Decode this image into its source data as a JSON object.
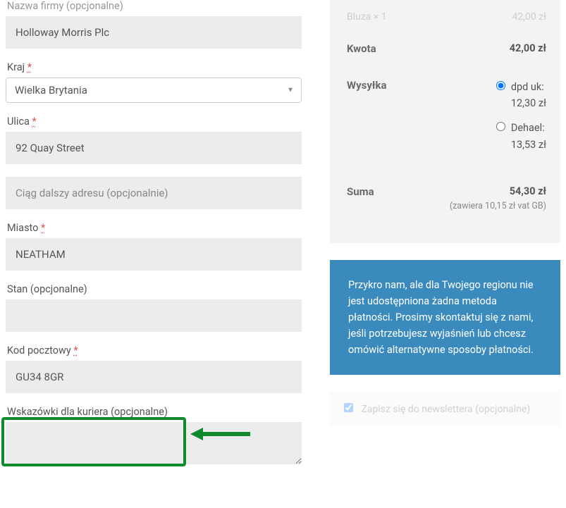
{
  "form": {
    "company_label": "Nazwa firmy (opcjonalne)",
    "company_value": "Holloway Morris Plc",
    "country_label": "Kraj",
    "country_value": "Wielka Brytania",
    "street_label": "Ulica",
    "street_value": "92 Quay Street",
    "street2_placeholder": "Ciąg dalszy adresu (opcjonalnie)",
    "city_label": "Miasto",
    "city_value": "NEATHAM",
    "state_label": "Stan (opcjonalne)",
    "state_value": "",
    "postcode_label": "Kod pocztowy",
    "postcode_value": "GU34 8GR",
    "courier_label": "Wskazówki dla kuriera (opcjonalne)"
  },
  "summary": {
    "item_name": "Bluza × 1",
    "item_price": "42,00 zł",
    "subtotal_label": "Kwota",
    "subtotal_value": "42,00 zł",
    "shipping_label": "Wysyłka",
    "ship_opt1_label": "dpd uk:",
    "ship_opt1_price": "12,30 zł",
    "ship_opt2_label": "Dehael:",
    "ship_opt2_price": "13,53 zł",
    "total_label": "Suma",
    "total_value": "54,30 zł",
    "vat_note": "(zawiera 10,15 zł vat GB)"
  },
  "info": {
    "message": "Przykro nam, ale dla Twojego regionu nie jest udostępniona żadna metoda płatności. Prosimy skontaktuj się z nami, jeśli potrzebujesz wyjaśnień lub chcesz omówić alternatywne sposoby płatności."
  },
  "newsletter": {
    "label": "Zapisz się do newslettera (opcjonalne)"
  },
  "required_mark": "*"
}
